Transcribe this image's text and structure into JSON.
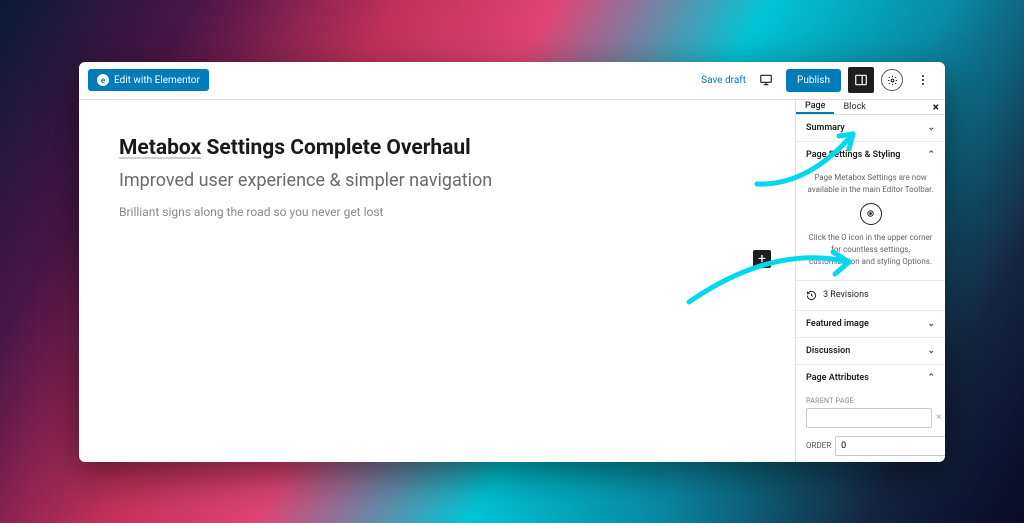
{
  "toolbar": {
    "edit_with_elementor": "Edit with Elementor",
    "save_draft": "Save draft",
    "publish": "Publish"
  },
  "editor": {
    "title_strong": "Metabox",
    "title_rest": " Settings Complete Overhaul",
    "subtitle": "Improved user experience & simpler navigation",
    "body": "Brilliant signs along the road so you never get lost"
  },
  "sidebar": {
    "tabs": {
      "page": "Page",
      "block": "Block"
    },
    "panels": {
      "summary": "Summary",
      "page_settings": "Page Settings & Styling",
      "ps_text1": "Page Metabox Settings are now available in the main Editor Toolbar.",
      "ps_text2": "Click the O icon in the upper corner for countless settings, customization and styling Options.",
      "revisions": "3 Revisions",
      "featured": "Featured image",
      "discussion": "Discussion",
      "attributes": "Page Attributes",
      "parent_page": "PARENT PAGE:",
      "order": "ORDER",
      "order_value": "0"
    }
  }
}
